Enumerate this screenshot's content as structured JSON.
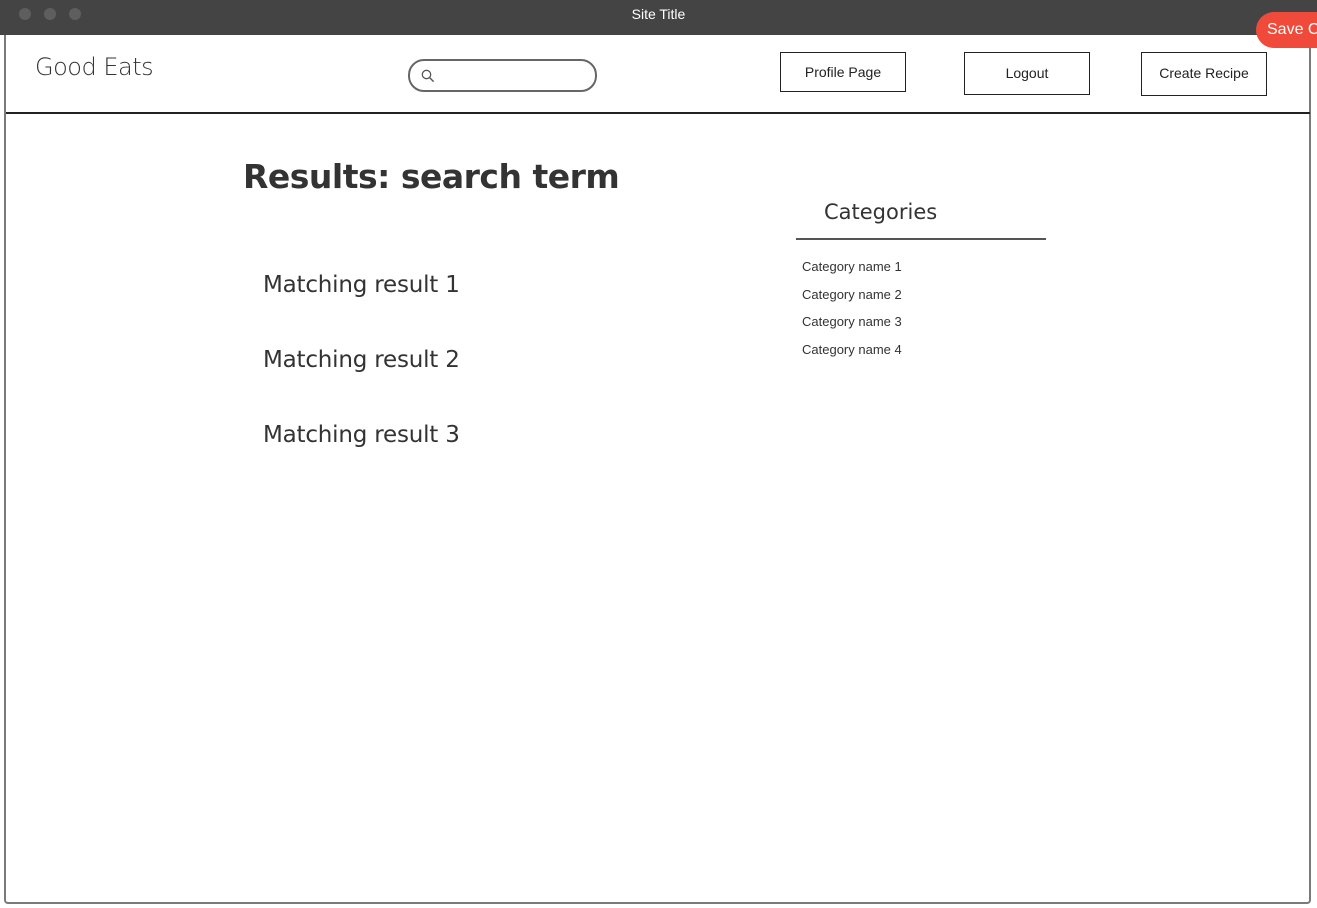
{
  "window": {
    "title": "Site Title",
    "save_label": "Save C"
  },
  "header": {
    "logo": "Good Eats",
    "search": {
      "value": "",
      "placeholder": ""
    },
    "nav": {
      "profile_label": "Profile Page",
      "logout_label": "Logout",
      "create_label": "Create Recipe"
    }
  },
  "main": {
    "results_title": "Results: search term",
    "results": [
      "Matching result 1",
      "Matching result 2",
      "Matching result 3"
    ]
  },
  "sidebar": {
    "heading": "Categories",
    "categories": [
      "Category name 1",
      "Category name 2",
      "Category name 3",
      "Category name 4"
    ]
  },
  "colors": {
    "titlebar": "#444444",
    "save_accent": "#f04a3a",
    "text": "#333333"
  }
}
